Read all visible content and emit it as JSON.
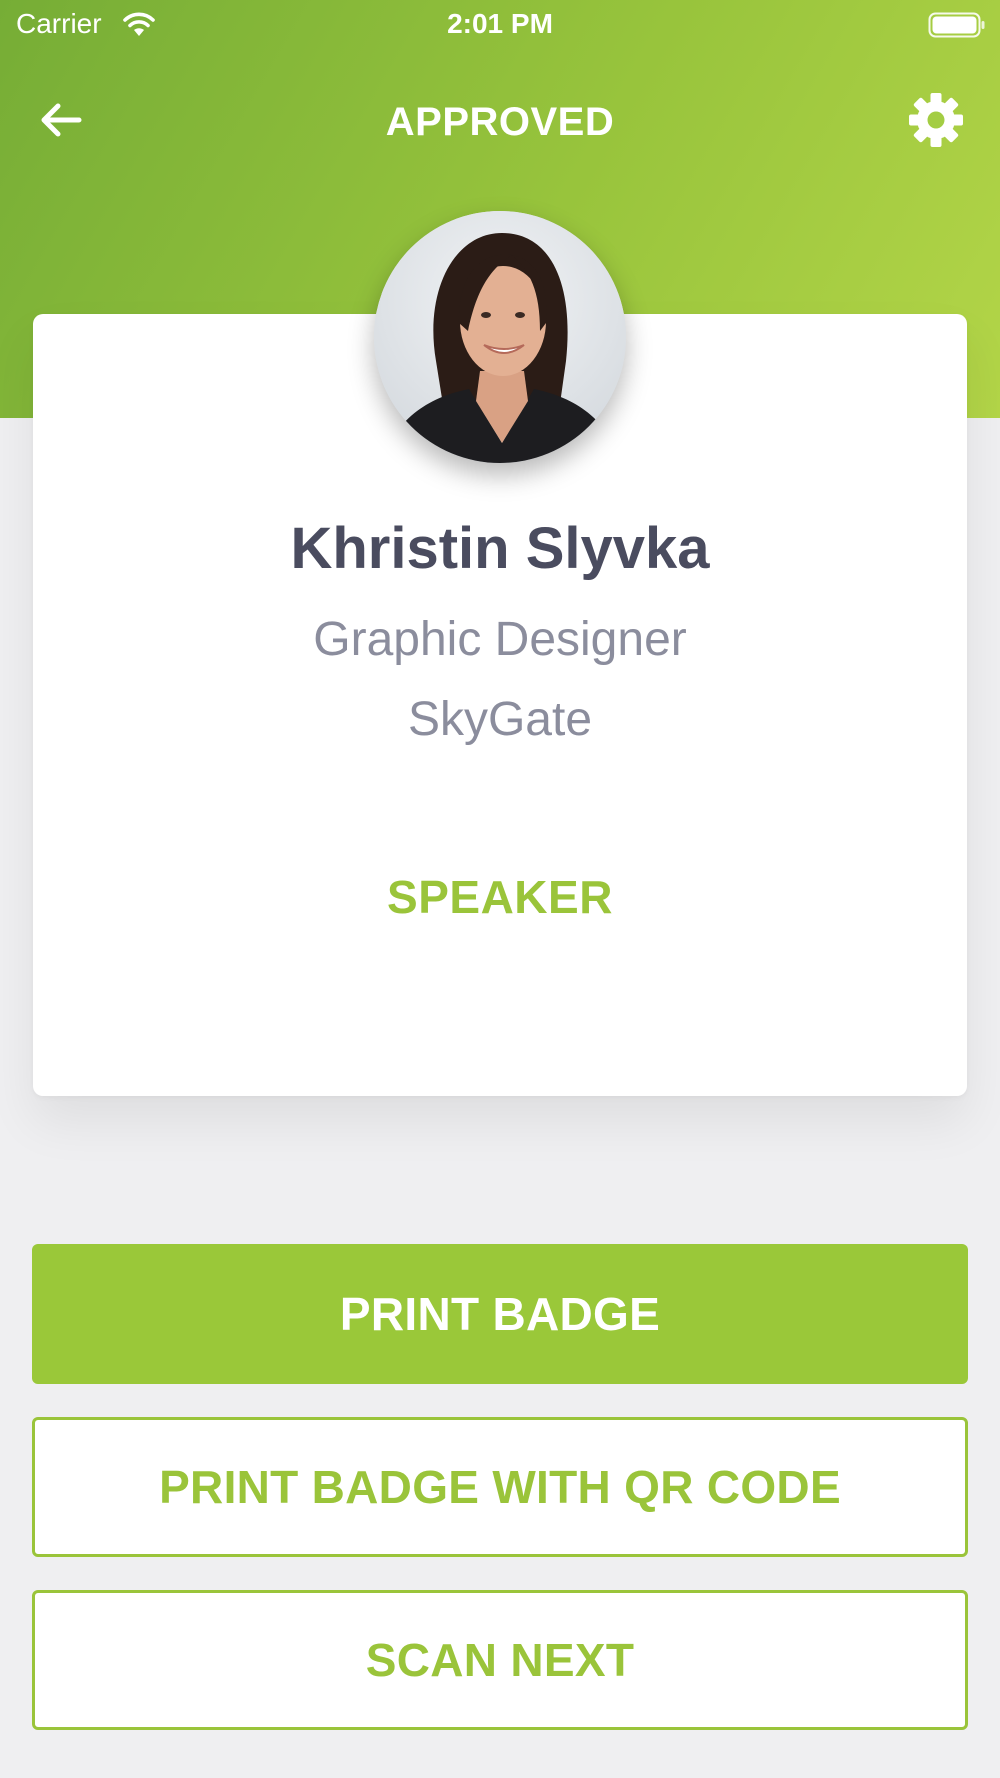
{
  "status_bar": {
    "carrier": "Carrier",
    "time": "2:01 PM",
    "icons": [
      "wifi-icon",
      "battery-icon"
    ]
  },
  "nav": {
    "title": "APPROVED",
    "back_icon": "arrow-left-icon",
    "settings_icon": "gear-icon"
  },
  "profile": {
    "name": "Khristin Slyvka",
    "job_title": "Graphic Designer",
    "company": "SkyGate",
    "attendee_type": "SPEAKER"
  },
  "actions": {
    "print_badge": "PRINT BADGE",
    "print_badge_qr": "PRINT BADGE WITH QR CODE",
    "scan_next": "SCAN NEXT"
  },
  "colors": {
    "accent": "#9ac839",
    "hero_gradient_start": "#76ad36",
    "hero_gradient_end": "#b3d548",
    "name_text": "#4a4c5f",
    "secondary_text": "#8b8d9d",
    "background": "#efeff1"
  }
}
